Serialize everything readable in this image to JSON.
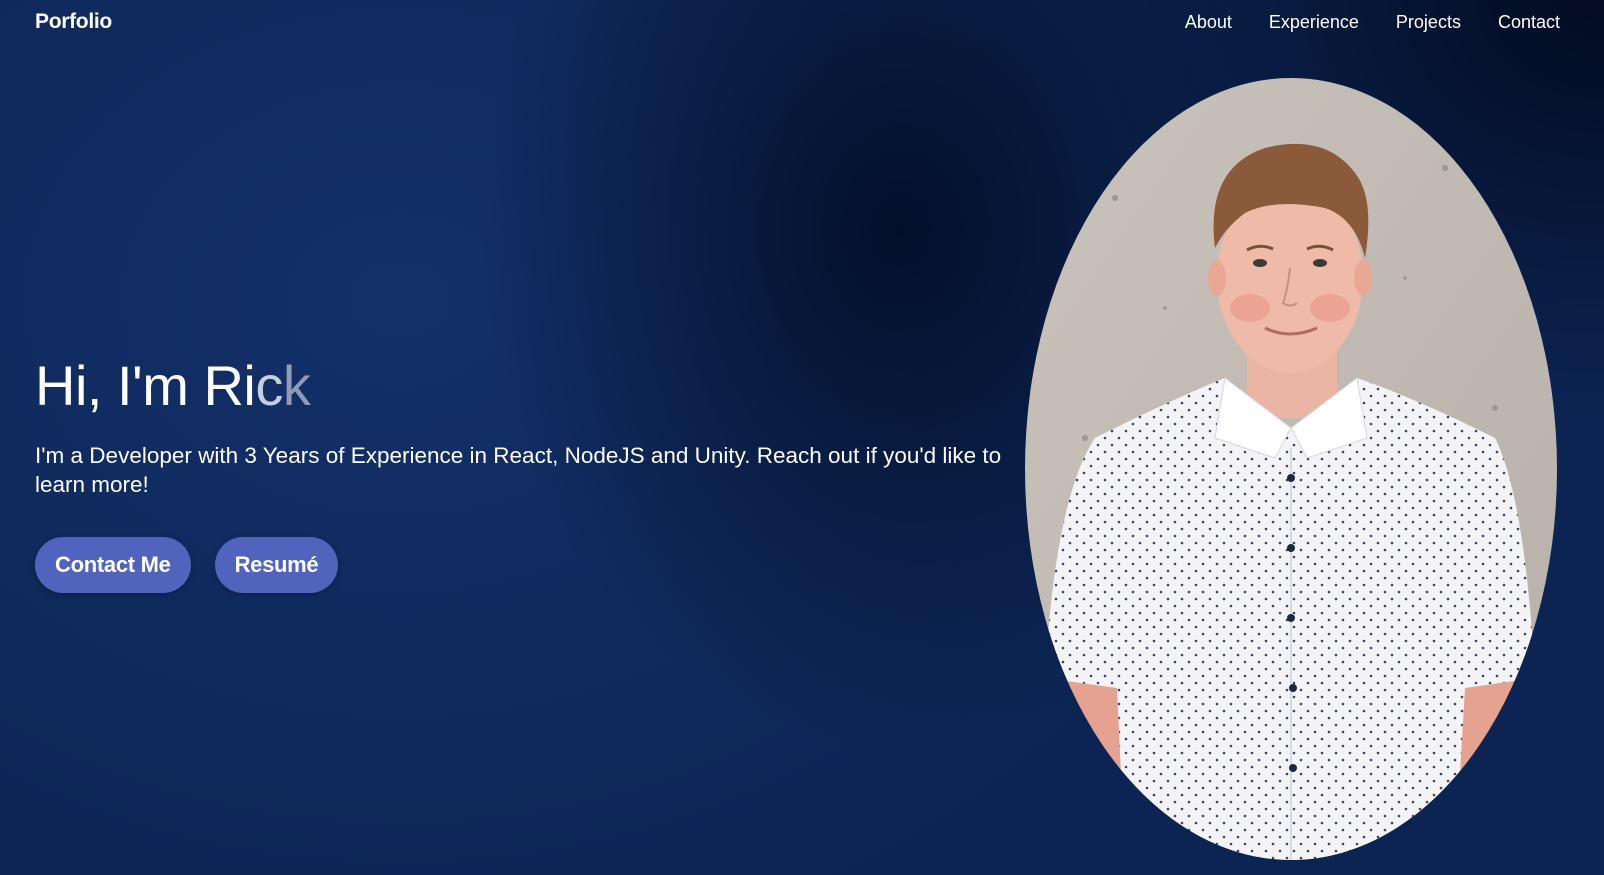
{
  "nav": {
    "brand": "Porfolio",
    "links": [
      "About",
      "Experience",
      "Projects",
      "Contact"
    ]
  },
  "hero": {
    "title_parts": [
      "Hi, I'm Ri",
      "c",
      "k"
    ],
    "description": "I'm a Developer with 3 Years of Experience in React, NodeJS and Unity. Reach out if you'd like to learn more!",
    "buttons": [
      "Contact Me",
      "Resumé"
    ]
  },
  "portrait": {
    "alt": "Portrait of Rick"
  },
  "colors": {
    "background": "#0f2a5c",
    "button": "#5063bd",
    "text": "#ffffff"
  }
}
